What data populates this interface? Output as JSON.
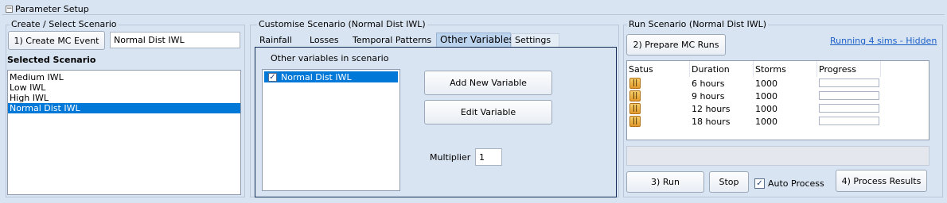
{
  "header": {
    "title": "Parameter Setup",
    "collapse_glyph": "−"
  },
  "create_group": {
    "title": "Create / Select Scenario",
    "create_button": "1) Create MC Event",
    "name_value": "Normal Dist IWL",
    "selected_label": "Selected Scenario",
    "scenarios": [
      {
        "label": "Medium IWL"
      },
      {
        "label": "Low IWL"
      },
      {
        "label": "High IWL"
      },
      {
        "label": "Normal Dist IWL",
        "selected": true
      }
    ]
  },
  "customise_group": {
    "title": "Customise Scenario (Normal Dist IWL)",
    "tabs": [
      {
        "label": "Rainfall"
      },
      {
        "label": "Losses"
      },
      {
        "label": "Temporal Patterns"
      },
      {
        "label": "Other Variables",
        "active": true
      },
      {
        "label": "Settings"
      }
    ],
    "panel_label": "Other variables in scenario",
    "variables": [
      {
        "label": "Normal Dist IWL",
        "checked": true,
        "check_glyph": "✓"
      }
    ],
    "add_button": "Add New Variable",
    "edit_button": "Edit Variable",
    "multiplier_label": "Multiplier",
    "multiplier_value": "1"
  },
  "run_group": {
    "title": "Run Scenario (Normal Dist IWL)",
    "prepare_button": "2) Prepare MC Runs",
    "running_link": "Running 4 sims - Hidden",
    "columns": [
      "Satus",
      "Duration",
      "Storms",
      "Progress"
    ],
    "rows": [
      {
        "icon": "pause-icon",
        "glyph": "||",
        "duration": "6 hours",
        "storms": "1000",
        "progress": 0
      },
      {
        "icon": "pause-icon",
        "glyph": "||",
        "duration": "9 hours",
        "storms": "1000",
        "progress": 0
      },
      {
        "icon": "pause-icon",
        "glyph": "||",
        "duration": "12 hours",
        "storms": "1000",
        "progress": 0
      },
      {
        "icon": "pause-icon",
        "glyph": "||",
        "duration": "18 hours",
        "storms": "1000",
        "progress": 0
      }
    ],
    "run_button": "3) Run",
    "stop_button": "Stop",
    "auto_process_label": "Auto Process",
    "auto_process_checked": true,
    "check_glyph": "✓",
    "process_button": "4) Process Results"
  },
  "colors": {
    "background": "#d9e4f2",
    "selection": "#0078d7",
    "link": "#1a5fc8",
    "status_icon": "#e39a2b"
  }
}
